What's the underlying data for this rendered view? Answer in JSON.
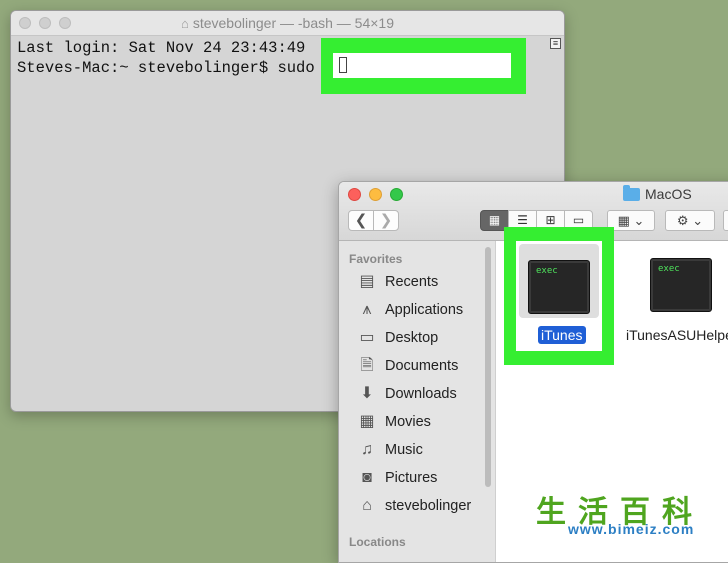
{
  "terminal": {
    "title": "stevebolinger — -bash — 54×19",
    "line1": "Last login: Sat Nov 24 23:43:49",
    "line2": "Steves-Mac:~ stevebolinger$ sudo"
  },
  "finder": {
    "title": "MacOS",
    "sidebar": {
      "favorites_heading": "Favorites",
      "items": [
        {
          "label": "Recents",
          "icon": "clock-icon"
        },
        {
          "label": "Applications",
          "icon": "applications-icon"
        },
        {
          "label": "Desktop",
          "icon": "desktop-icon"
        },
        {
          "label": "Documents",
          "icon": "document-icon"
        },
        {
          "label": "Downloads",
          "icon": "download-icon"
        },
        {
          "label": "Movies",
          "icon": "film-icon"
        },
        {
          "label": "Music",
          "icon": "music-icon"
        },
        {
          "label": "Pictures",
          "icon": "camera-icon"
        },
        {
          "label": "stevebolinger",
          "icon": "home-icon"
        }
      ],
      "locations_heading": "Locations"
    },
    "files": [
      {
        "name": "iTunes",
        "badge": "exec",
        "selected": true
      },
      {
        "name": "iTunesASUHelper",
        "badge": "exec",
        "selected": false
      }
    ]
  },
  "watermark": {
    "logo": "生活百科",
    "url": "www.bimeiz.com"
  },
  "colors": {
    "highlight": "#35ee31",
    "selection": "#1f5fd6",
    "desktop": "#93a97c"
  }
}
